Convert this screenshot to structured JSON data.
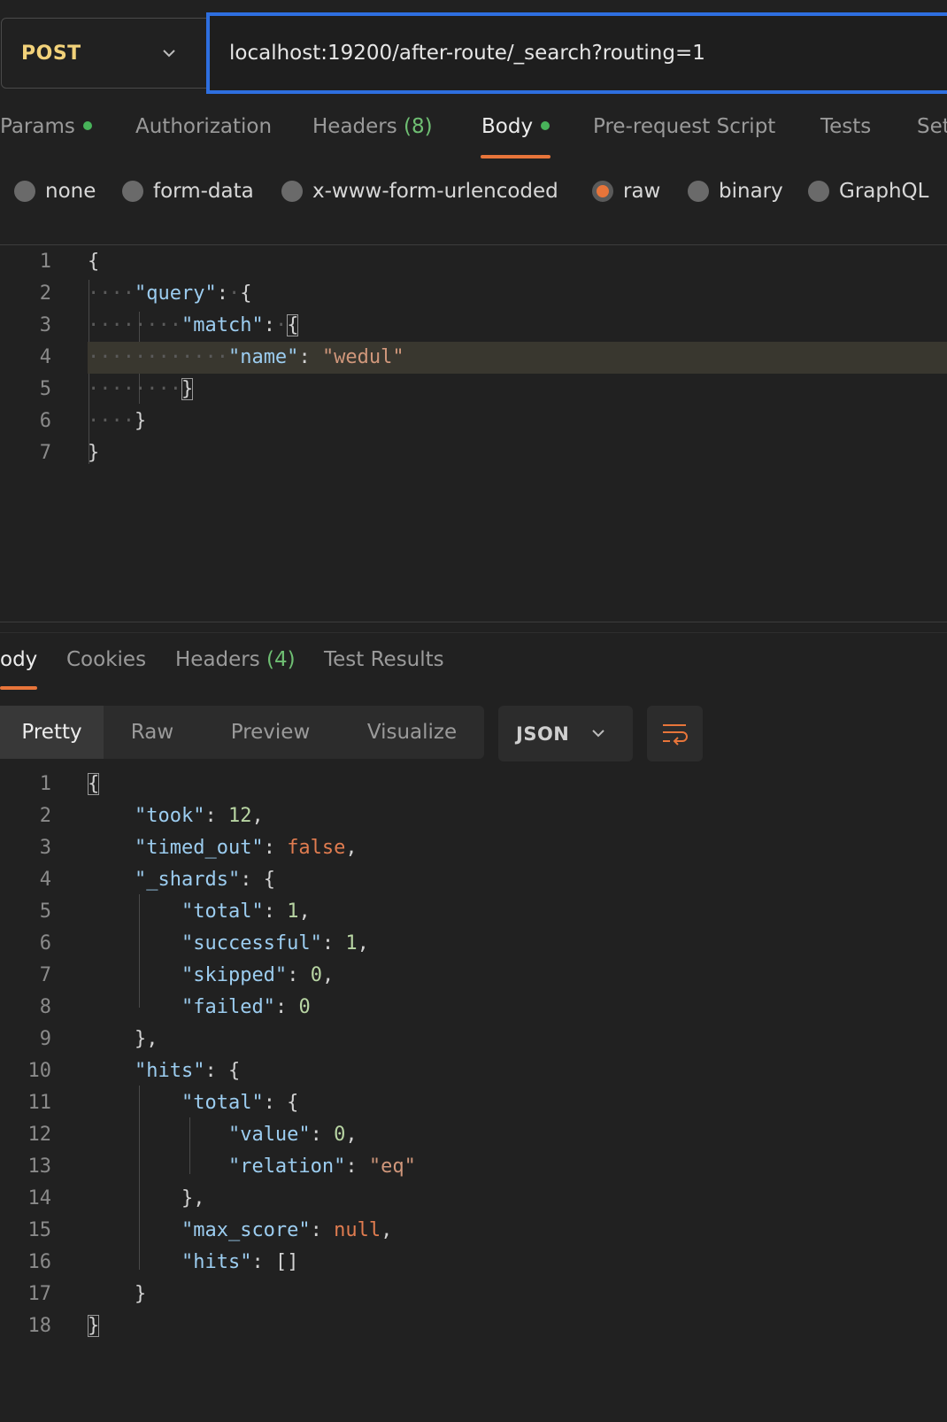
{
  "request": {
    "method": "POST",
    "url": "localhost:19200/after-route/_search?routing=1"
  },
  "request_tabs": {
    "params": "Params",
    "authorization": "Authorization",
    "headers": "Headers",
    "headers_count": "(8)",
    "body": "Body",
    "pre_request": "Pre-request Script",
    "tests": "Tests",
    "settings": "Set"
  },
  "body_types": [
    "none",
    "form-data",
    "x-www-form-urlencoded",
    "raw",
    "binary",
    "GraphQL"
  ],
  "request_body": {
    "line_numbers": [
      "1",
      "2",
      "3",
      "4",
      "5",
      "6",
      "7"
    ],
    "query_key": "\"query\"",
    "match_key": "\"match\"",
    "name_key": "\"name\"",
    "name_value": "\"wedul\""
  },
  "response_tabs": {
    "body": "ody",
    "cookies": "Cookies",
    "headers": "Headers",
    "headers_count": "(4)",
    "test_results": "Test Results"
  },
  "view_modes": [
    "Pretty",
    "Raw",
    "Preview",
    "Visualize"
  ],
  "format": "JSON",
  "response_body": {
    "line_numbers": [
      "1",
      "2",
      "3",
      "4",
      "5",
      "6",
      "7",
      "8",
      "9",
      "10",
      "11",
      "12",
      "13",
      "14",
      "15",
      "16",
      "17",
      "18"
    ],
    "took_key": "\"took\"",
    "took": "12",
    "timed_out_key": "\"timed_out\"",
    "timed_out": "false",
    "shards_key": "\"_shards\"",
    "total_key": "\"total\"",
    "shards_total": "1",
    "successful_key": "\"successful\"",
    "successful": "1",
    "skipped_key": "\"skipped\"",
    "skipped": "0",
    "failed_key": "\"failed\"",
    "failed": "0",
    "hits_key": "\"hits\"",
    "value_key": "\"value\"",
    "value": "0",
    "relation_key": "\"relation\"",
    "relation": "\"eq\"",
    "max_score_key": "\"max_score\"",
    "max_score": "null",
    "inner_hits_key": "\"hits\"",
    "inner_hits": "[]"
  }
}
